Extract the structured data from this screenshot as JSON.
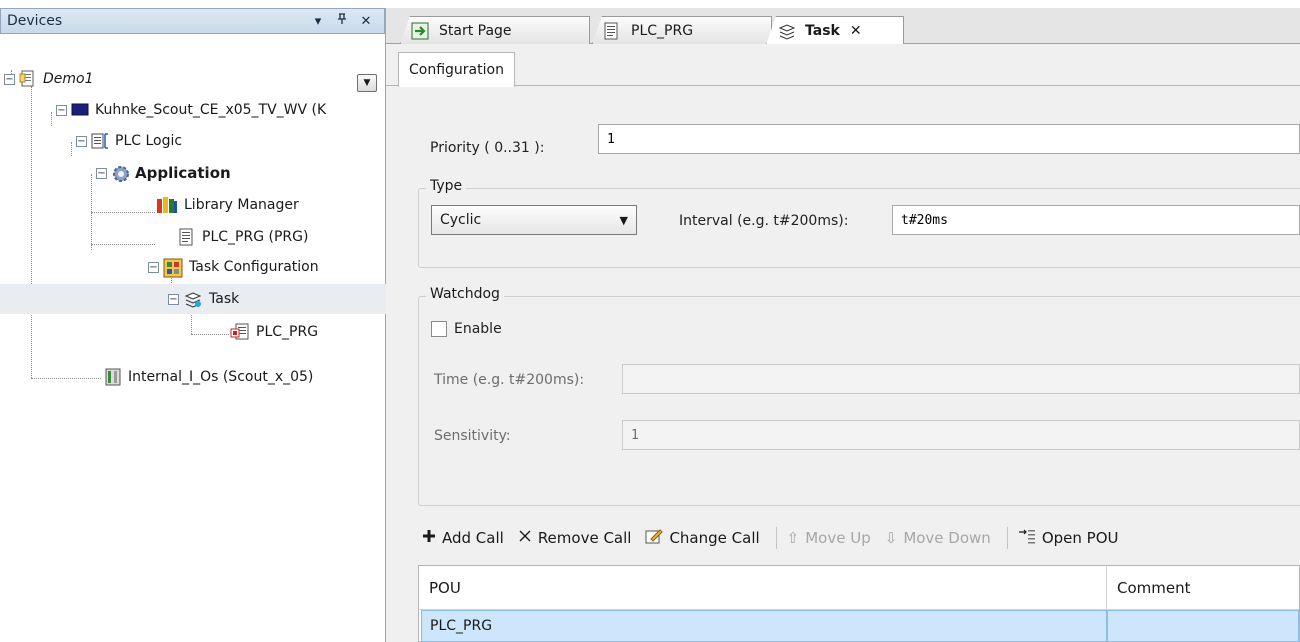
{
  "devices_panel": {
    "title": "Devices",
    "buttons": {
      "dropdown": "▾",
      "pin": "ᵖ",
      "close": "✕"
    },
    "tree": {
      "project": "Demo1",
      "device": "Kuhnke_Scout_CE_x05_TV_WV (K",
      "plc_logic": "PLC Logic",
      "application": "Application",
      "library_manager": "Library Manager",
      "plc_prg": "PLC_PRG (PRG)",
      "task_configuration": "Task Configuration",
      "task": "Task",
      "task_pou": "PLC_PRG",
      "internal_ios": "Internal_I_Os (Scout_x_05)"
    }
  },
  "editor": {
    "tabs": [
      {
        "label": "Start Page"
      },
      {
        "label": "PLC_PRG"
      },
      {
        "label": "Task",
        "close": "✕"
      }
    ],
    "config_tab": "Configuration",
    "priority": {
      "label": "Priority ( 0..31 ):",
      "value": "1"
    },
    "type_group": {
      "title": "Type",
      "selected": "Cyclic",
      "interval_label": "Interval (e.g. t#200ms):",
      "interval_value": "t#20ms"
    },
    "watchdog_group": {
      "title": "Watchdog",
      "enable_label": "Enable",
      "enable_checked": false,
      "time_label": "Time (e.g. t#200ms):",
      "time_value": "",
      "sensitivity_label": "Sensitivity:",
      "sensitivity_value": "1"
    },
    "toolbar": {
      "add_call": "Add Call",
      "remove_call": "Remove Call",
      "change_call": "Change Call",
      "move_up": "Move Up",
      "move_down": "Move Down",
      "open_pou": "Open POU"
    },
    "table": {
      "columns": [
        "POU",
        "Comment"
      ],
      "rows": [
        {
          "pou": "PLC_PRG",
          "comment": ""
        }
      ]
    }
  },
  "colors": {
    "selection": "#cde6fb",
    "header_gradient": "#c9d9ea"
  }
}
